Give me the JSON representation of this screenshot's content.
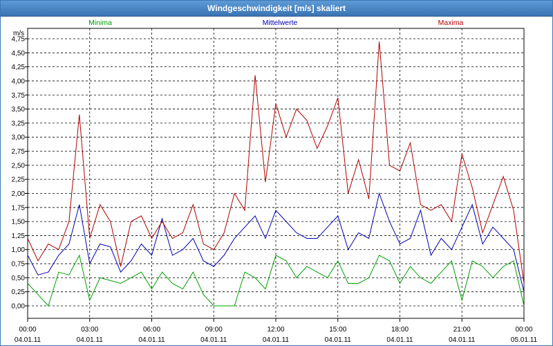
{
  "window": {
    "title": "Windgeschwindigkeit [m/s] skaliert"
  },
  "chart_data": {
    "type": "line",
    "title": "Windgeschwindigkeit [m/s] skaliert",
    "ylabel": "m/s",
    "ylim": [
      0,
      4.75
    ],
    "yticks": [
      "0,00",
      "0,25",
      "0,50",
      "0,75",
      "1,00",
      "1,25",
      "1,50",
      "1,75",
      "2,00",
      "2,25",
      "2,50",
      "2,75",
      "3,00",
      "3,25",
      "3,50",
      "3,75",
      "4,00",
      "4,25",
      "4,50",
      "4,75"
    ],
    "xticks": [
      {
        "time": "00:00",
        "date": "04.01.11"
      },
      {
        "time": "03:00",
        "date": "04.01.11"
      },
      {
        "time": "06:00",
        "date": "04.01.11"
      },
      {
        "time": "09:00",
        "date": "04.01.11"
      },
      {
        "time": "12:00",
        "date": "04.01.11"
      },
      {
        "time": "15:00",
        "date": "04.01.11"
      },
      {
        "time": "18:00",
        "date": "04.01.11"
      },
      {
        "time": "21:00",
        "date": "04.01.11"
      },
      {
        "time": "00:00",
        "date": "05.01.11"
      }
    ],
    "grid": true,
    "legend_position": "top",
    "x_hours": [
      0,
      0.5,
      1,
      1.5,
      2,
      2.5,
      3,
      3.5,
      4,
      4.5,
      5,
      5.5,
      6,
      6.5,
      7,
      7.5,
      8,
      8.5,
      9,
      9.5,
      10,
      10.5,
      11,
      11.5,
      12,
      12.5,
      13,
      13.5,
      14,
      14.5,
      15,
      15.5,
      16,
      16.5,
      17,
      17.5,
      18,
      18.5,
      19,
      19.5,
      20,
      20.5,
      21,
      21.5,
      22,
      22.5,
      23,
      23.5,
      24
    ],
    "series": [
      {
        "name": "Minima",
        "color": "#00a000",
        "values": [
          0.4,
          0.2,
          0,
          0.6,
          0.55,
          0.9,
          0.1,
          0.5,
          0.45,
          0.4,
          0.5,
          0.6,
          0.3,
          0.6,
          0.4,
          0.3,
          0.6,
          0.2,
          0,
          0,
          0,
          0.6,
          0.5,
          0.3,
          0.9,
          0.8,
          0.5,
          0.7,
          0.6,
          0.5,
          0.8,
          0.4,
          0.4,
          0.5,
          0.9,
          0.8,
          0.4,
          0.7,
          0.5,
          0.4,
          0.6,
          0.8,
          0.1,
          0.8,
          0.7,
          0.5,
          0.7,
          0.8,
          0
        ]
      },
      {
        "name": "Mittelwerte",
        "color": "#0000b0",
        "values": [
          0.9,
          0.55,
          0.6,
          0.9,
          1.1,
          1.8,
          0.75,
          1.1,
          1.05,
          0.6,
          0.8,
          1.1,
          0.9,
          1.55,
          0.9,
          1,
          1.2,
          0.8,
          0.7,
          0.9,
          1.2,
          1.4,
          1.6,
          1.2,
          1.7,
          1.5,
          1.3,
          1.2,
          1.2,
          1.4,
          1.6,
          1,
          1.3,
          1.2,
          2,
          1.5,
          1.1,
          1.2,
          1.7,
          0.9,
          1.2,
          1.0,
          1.4,
          1.8,
          1.1,
          1.4,
          1.2,
          1.0,
          0.25
        ]
      },
      {
        "name": "Maxima",
        "color": "#b00000",
        "values": [
          1.2,
          0.8,
          1.1,
          1.0,
          1.5,
          3.4,
          1.2,
          1.8,
          1.5,
          0.7,
          1.5,
          1.6,
          1.2,
          1.5,
          1.2,
          1.3,
          1.8,
          1.1,
          1.0,
          1.3,
          2.0,
          1.7,
          4.1,
          2.2,
          3.6,
          3.0,
          3.5,
          3.3,
          2.8,
          3.2,
          3.7,
          2.0,
          2.6,
          1.9,
          4.7,
          2.5,
          2.4,
          2.9,
          1.8,
          1.7,
          1.8,
          1.5,
          2.7,
          2.1,
          1.3,
          1.8,
          2.3,
          1.7,
          0.4
        ]
      }
    ]
  }
}
